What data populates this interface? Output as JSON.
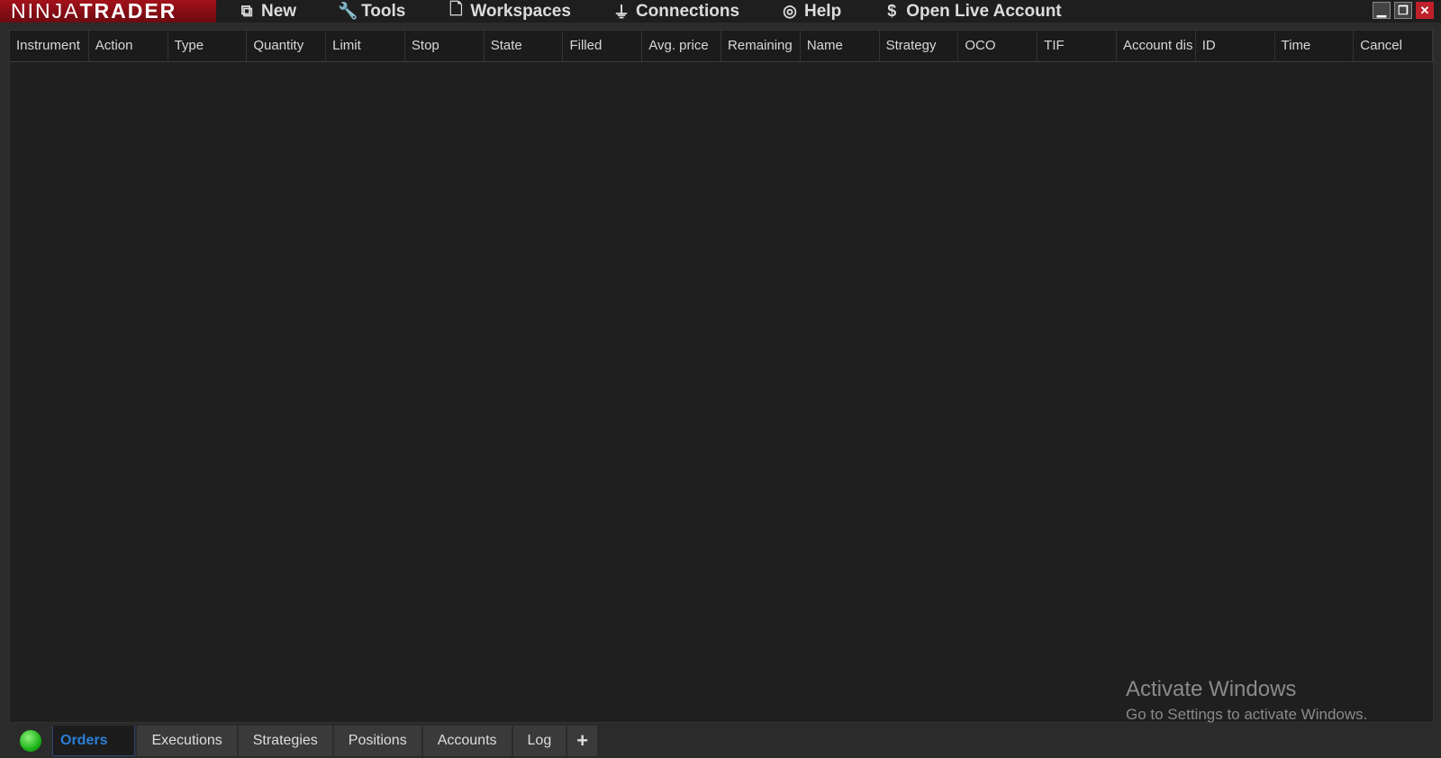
{
  "menubar": {
    "logo": {
      "light": "NINJA",
      "bold": "TRADER"
    },
    "items": [
      {
        "label": "New",
        "icon": "new-window-icon",
        "glyph": "⧉"
      },
      {
        "label": "Tools",
        "icon": "wrench-icon",
        "glyph": "🔧"
      },
      {
        "label": "Workspaces",
        "icon": "document-icon",
        "glyph": "🗋"
      },
      {
        "label": "Connections",
        "icon": "plug-icon",
        "glyph": "⏚"
      },
      {
        "label": "Help",
        "icon": "lifebuoy-icon",
        "glyph": "◎"
      },
      {
        "label": "Open Live Account",
        "icon": "dollar-icon",
        "glyph": "$"
      }
    ]
  },
  "window": {
    "minimize": "▁",
    "restore": "❐",
    "close": "✕"
  },
  "columns": [
    "Instrument",
    "Action",
    "Type",
    "Quantity",
    "Limit",
    "Stop",
    "State",
    "Filled",
    "Avg. price",
    "Remaining",
    "Name",
    "Strategy",
    "OCO",
    "TIF",
    "Account dis",
    "ID",
    "Time",
    "Cancel"
  ],
  "watermark": {
    "title": "Activate Windows",
    "subtitle": "Go to Settings to activate Windows."
  },
  "tabs": [
    "Orders",
    "Executions",
    "Strategies",
    "Positions",
    "Accounts",
    "Log"
  ],
  "add_tab": "+",
  "colors": {
    "accent": "#2b7fd6",
    "brand": "#a3121b",
    "status": "#1fb41a"
  }
}
